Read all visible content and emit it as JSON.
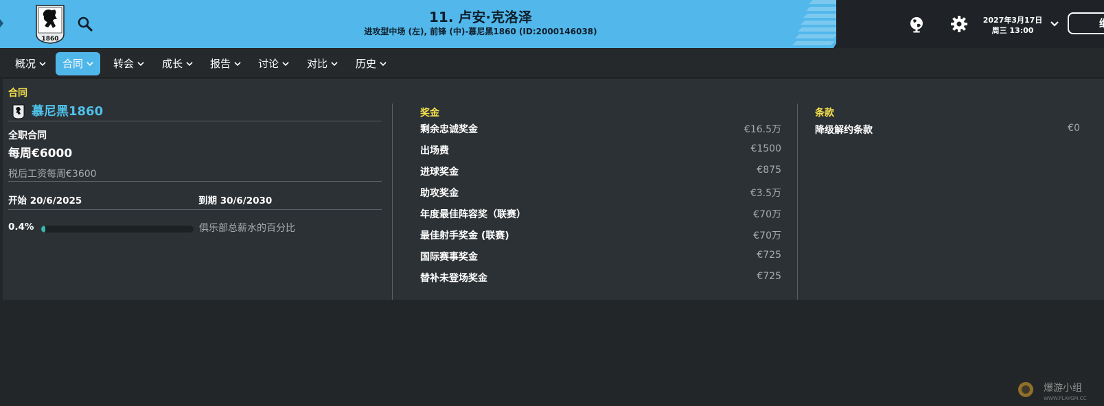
{
  "header": {
    "title": "11. 卢安·克洛泽",
    "subtitle": "进攻型中场 (左), 前锋 (中)-慕尼黑1860 (ID:2000146038)",
    "crest_text": "1860",
    "date": "2027年3月17日",
    "weekday_time": "周三 13:00",
    "continue_label": "继",
    "brand_color": "#52b8eb",
    "icons": [
      "search-icon",
      "globe-icon",
      "gear-icon",
      "chevron-down-icon"
    ]
  },
  "tabs": [
    {
      "label": "概况",
      "active": false
    },
    {
      "label": "合同",
      "active": true
    },
    {
      "label": "转会",
      "active": false
    },
    {
      "label": "成长",
      "active": false
    },
    {
      "label": "报告",
      "active": false
    },
    {
      "label": "讨论",
      "active": false
    },
    {
      "label": "对比",
      "active": false
    },
    {
      "label": "历史",
      "active": false
    }
  ],
  "contract": {
    "section_title": "合同",
    "club": "慕尼黑1860",
    "type": "全职合同",
    "wage": "每周€6000",
    "after_tax": "税后工资每周€3600",
    "start": "开始 20/6/2025",
    "end": "到期 30/6/2030",
    "wage_share_value": "0.4%",
    "wage_share_fraction": 0.004,
    "wage_share_label": "俱乐部总薪水的百分比"
  },
  "bonuses": {
    "title": "奖金",
    "items": [
      {
        "label": "剩余忠诚奖金",
        "value": "€16.5万"
      },
      {
        "label": "出场费",
        "value": "€1500"
      },
      {
        "label": "进球奖金",
        "value": "€875"
      },
      {
        "label": "助攻奖金",
        "value": "€3.5万"
      },
      {
        "label": "年度最佳阵容奖（联赛）",
        "value": "€70万"
      },
      {
        "label": "最佳射手奖金 (联赛)",
        "value": "€70万"
      },
      {
        "label": "国际赛事奖金",
        "value": "€725"
      },
      {
        "label": "替补未登场奖金",
        "value": "€725"
      }
    ]
  },
  "clauses": {
    "title": "条款",
    "items": [
      {
        "label": "降级解约条款",
        "value": "€0"
      }
    ]
  },
  "watermark": {
    "text": "爆游小组",
    "url": "WWW.PLAYGM.CC"
  }
}
